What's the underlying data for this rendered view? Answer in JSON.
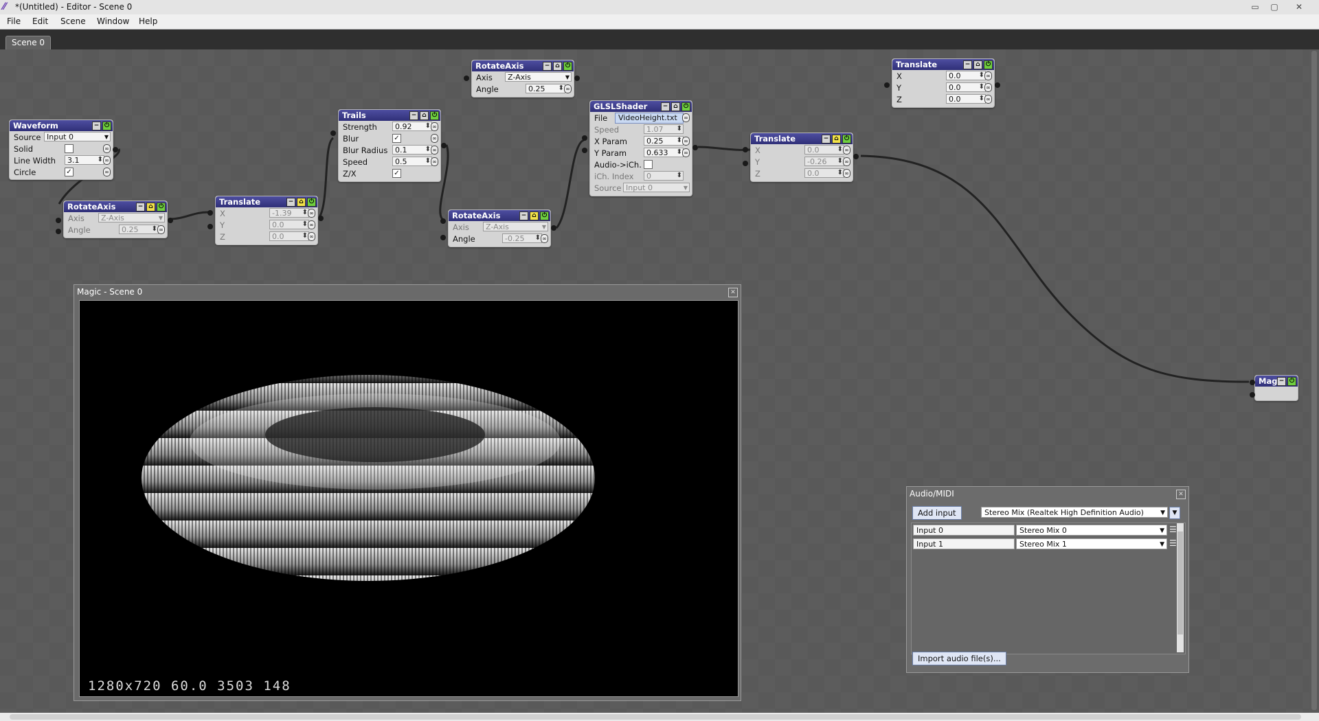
{
  "window": {
    "title": "*(Untitled) - Editor - Scene 0",
    "minimize": "▭",
    "maximize": "▢",
    "close": "✕",
    "icon": "magic-logo-icon"
  },
  "menu": [
    "File",
    "Edit",
    "Scene",
    "Window",
    "Help"
  ],
  "tabs": [
    "Scene 0"
  ],
  "nodes": {
    "waveform": {
      "title": "Waveform",
      "source_label": "Source",
      "source_value": "Input 0",
      "solid_label": "Solid",
      "line_width_label": "Line Width",
      "line_width_value": "3.1",
      "circle_label": "Circle",
      "circle_checked": "✓"
    },
    "rotate1": {
      "title": "RotateAxis",
      "axis_label": "Axis",
      "axis_value": "Z-Axis",
      "angle_label": "Angle",
      "angle_value": "0.25"
    },
    "translate1": {
      "title": "Translate",
      "x_label": "X",
      "x_value": "-1.39",
      "y_label": "Y",
      "y_value": "0.0",
      "z_label": "Z",
      "z_value": "0.0"
    },
    "trails": {
      "title": "Trails",
      "strength_label": "Strength",
      "strength_value": "0.92",
      "blur_label": "Blur",
      "blur_checked": "✓",
      "blur_radius_label": "Blur Radius",
      "blur_radius_value": "0.1",
      "speed_label": "Speed",
      "speed_value": "0.5",
      "zx_label": "Z/X",
      "zx_checked": "✓"
    },
    "rotate_top": {
      "title": "RotateAxis",
      "axis_label": "Axis",
      "axis_value": "Z-Axis",
      "angle_label": "Angle",
      "angle_value": "0.25"
    },
    "rotate2": {
      "title": "RotateAxis",
      "axis_label": "Axis",
      "axis_value": "Z-Axis",
      "angle_label": "Angle",
      "angle_value": "-0.25"
    },
    "glsl": {
      "title": "GLSLShader",
      "file_label": "File",
      "file_value": "VideoHeight.txt",
      "speed_label": "Speed",
      "speed_value": "1.07",
      "xparam_label": "X Param",
      "xparam_value": "0.25",
      "yparam_label": "Y Param",
      "yparam_value": "0.633",
      "audio_label": "Audio->iCh.",
      "ich_label": "iCh. Index",
      "ich_value": "0",
      "source_label": "Source",
      "source_value": "Input 0"
    },
    "translate2": {
      "title": "Translate",
      "x_label": "X",
      "x_value": "0.0",
      "y_label": "Y",
      "y_value": "-0.26",
      "z_label": "Z",
      "z_value": "0.0"
    },
    "translate_top": {
      "title": "Translate",
      "x_label": "X",
      "x_value": "0.0",
      "y_label": "Y",
      "y_value": "0.0",
      "z_label": "Z",
      "z_value": "0.0"
    },
    "magic": {
      "title": "Magic"
    }
  },
  "preview": {
    "title": "Magic - Scene 0",
    "stats": "1280x720 60.0 3503 148"
  },
  "audio_midi": {
    "title": "Audio/MIDI",
    "add_input": "Add input",
    "device": "Stereo Mix (Realtek High Definition Audio)",
    "inputs": [
      {
        "name": "Input 0",
        "channel": "Stereo Mix 0"
      },
      {
        "name": "Input 1",
        "channel": "Stereo Mix 1"
      }
    ],
    "import_button": "Import audio file(s)..."
  },
  "colors": {
    "node_header": "#2f2f78",
    "canvas": "#5c5c5c",
    "tab_bar": "#2f2f2f"
  }
}
